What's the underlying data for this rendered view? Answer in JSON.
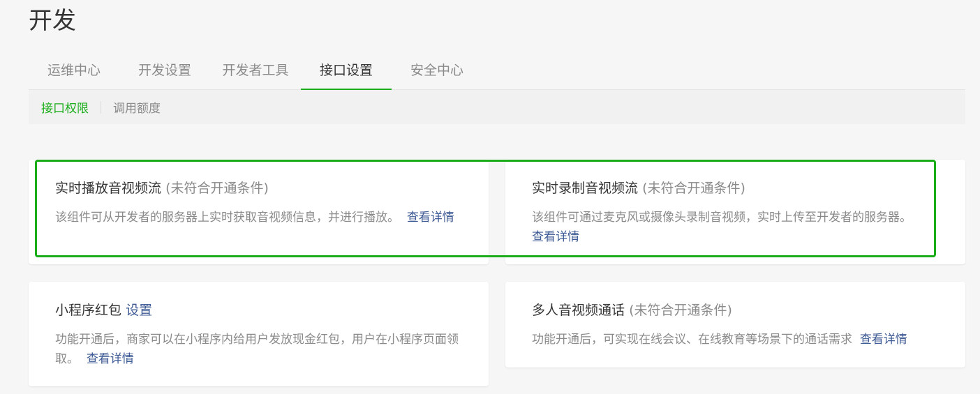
{
  "page": {
    "title": "开发"
  },
  "tabs": [
    {
      "label": "运维中心",
      "active": false
    },
    {
      "label": "开发设置",
      "active": false
    },
    {
      "label": "开发者工具",
      "active": false
    },
    {
      "label": "接口设置",
      "active": true
    },
    {
      "label": "安全中心",
      "active": false
    }
  ],
  "subnav": [
    {
      "label": "接口权限",
      "active": true
    },
    {
      "label": "调用额度",
      "active": false
    }
  ],
  "cards": [
    {
      "title": "实时播放音视频流",
      "status": "(未符合开通条件)",
      "description": "该组件可从开发者的服务器上实时获取音视频信息，并进行播放。",
      "detail_link": "查看详情"
    },
    {
      "title": "实时录制音视频流",
      "status": "(未符合开通条件)",
      "description": "该组件可通过麦克风或摄像头录制音视频，实时上传至开发者的服务器。",
      "detail_link": "查看详情"
    },
    {
      "title": "小程序红包",
      "title_link": "设置",
      "description": "功能开通后，商家可以在小程序内给用户发放现金红包，用户在小程序页面领取。",
      "detail_link": "查看详情"
    },
    {
      "title": "多人音视频通话",
      "status": "(未符合开通条件)",
      "description": "功能开通后，可实现在线会议、在线教育等场景下的通话需求",
      "detail_link": "查看详情"
    }
  ],
  "colors": {
    "accent": "#1aad19",
    "link": "#3d5a94",
    "muted": "#8a8a8a"
  }
}
